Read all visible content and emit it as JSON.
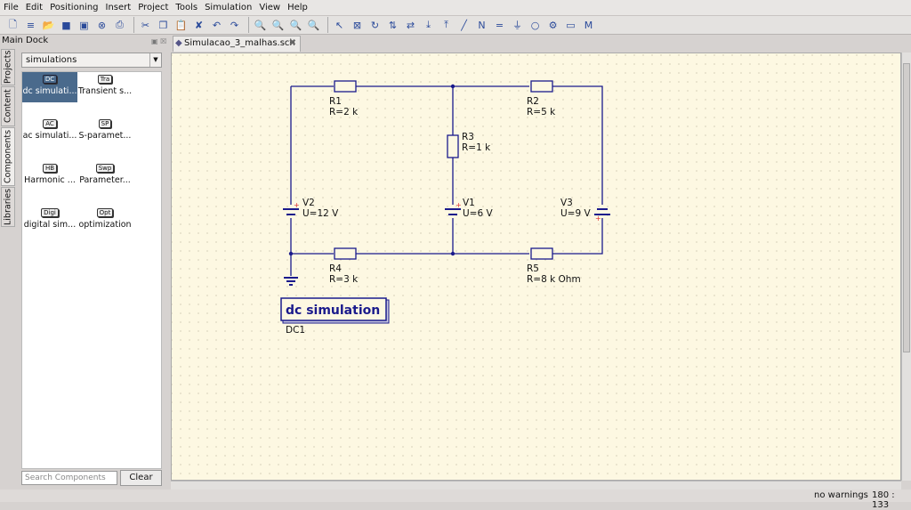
{
  "menu": [
    "File",
    "Edit",
    "Positioning",
    "Insert",
    "Project",
    "Tools",
    "Simulation",
    "View",
    "Help"
  ],
  "toolbar": {
    "groups": [
      [
        "new-document-icon",
        "new-text-icon",
        "open-icon",
        "save-icon",
        "save-all-icon",
        "close-icon",
        "print-icon"
      ],
      [
        "cut-icon",
        "copy-icon",
        "paste-icon",
        "delete-icon",
        "undo-icon",
        "redo-icon"
      ],
      [
        "zoom-fit-icon",
        "zoom-in-icon",
        "zoom-out-icon",
        "zoom-selection-icon"
      ],
      [
        "select-icon",
        "deactivate-icon",
        "rotate-icon",
        "mirror-x-icon",
        "mirror-y-icon",
        "enter-subcircuit-icon",
        "exit-subcircuit-icon",
        "wire-icon",
        "wire-label-icon",
        "equation-icon",
        "ground-icon",
        "port-icon",
        "simulate-icon",
        "view-data-icon",
        "marker-icon"
      ]
    ]
  },
  "dock": {
    "title": "Main Dock",
    "tabs": [
      "Projects",
      "Content",
      "Components",
      "Libraries"
    ],
    "active_tab": "Components",
    "category": "simulations",
    "items": [
      {
        "icon": "DC",
        "label": "dc simulati..."
      },
      {
        "icon": "Tra",
        "label": "Transient s..."
      },
      {
        "icon": "AC",
        "label": "ac simulati..."
      },
      {
        "icon": "SP",
        "label": "S-paramet..."
      },
      {
        "icon": "HB",
        "label": "Harmonic ..."
      },
      {
        "icon": "Swp",
        "label": "Parameter..."
      },
      {
        "icon": "Digi",
        "label": "digital sim..."
      },
      {
        "icon": "Opt",
        "label": "optimization"
      }
    ],
    "selected": 0,
    "search_placeholder": "Search Components",
    "clear_label": "Clear"
  },
  "document_tab": "Simulacao_3_malhas.sch",
  "schematic": {
    "wire_color": "#1a1a8c",
    "components": [
      {
        "name": "R1",
        "value": "R=2 k"
      },
      {
        "name": "R2",
        "value": "R=5 k"
      },
      {
        "name": "R3",
        "value": "R=1 k"
      },
      {
        "name": "R4",
        "value": "R=3 k"
      },
      {
        "name": "R5",
        "value": "R=8 k Ohm"
      },
      {
        "name": "V1",
        "value": "U=6 V"
      },
      {
        "name": "V2",
        "value": "U=12 V"
      },
      {
        "name": "V3",
        "value": "U=9 V"
      }
    ],
    "simulation": {
      "label": "dc simulation",
      "name": "DC1"
    }
  },
  "status": {
    "warnings": "no warnings",
    "coords": "180 : 133"
  }
}
